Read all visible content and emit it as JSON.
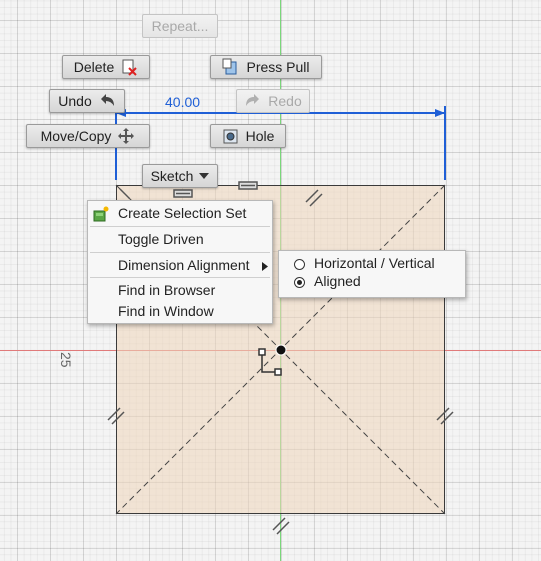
{
  "marking_menu": {
    "repeat": "Repeat...",
    "delete": "Delete",
    "press_pull": "Press Pull",
    "undo": "Undo",
    "redo": "Redo",
    "move_copy": "Move/Copy",
    "hole": "Hole",
    "sketch": "Sketch"
  },
  "dimensions": {
    "horizontal": "40.00",
    "label_top": "25",
    "label_left": "25"
  },
  "context_menu": {
    "create_selection_set": "Create Selection Set",
    "toggle_driven": "Toggle Driven",
    "dimension_alignment": "Dimension Alignment",
    "find_in_browser": "Find in Browser",
    "find_in_window": "Find in Window"
  },
  "submenu": {
    "options": [
      {
        "label": "Horizontal / Vertical",
        "selected": false
      },
      {
        "label": "Aligned",
        "selected": true
      }
    ]
  },
  "colors": {
    "dimension_blue": "#1f5fd6",
    "axis_green": "#7ad77a",
    "axis_red": "#e07a7a"
  },
  "icons": [
    "delete-icon",
    "press-pull-icon",
    "undo-icon",
    "redo-icon",
    "move-icon",
    "hole-icon",
    "dropdown-icon",
    "selection-set-icon",
    "submenu-arrow-icon"
  ]
}
